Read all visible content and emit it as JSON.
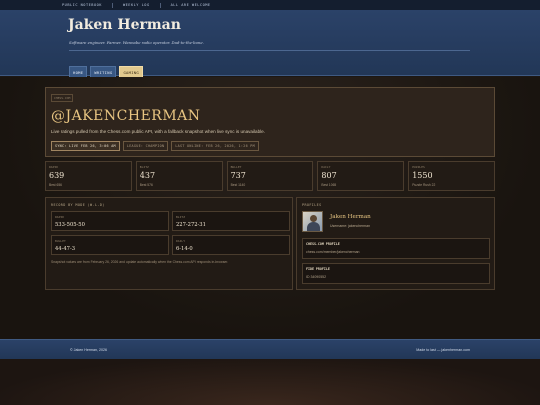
{
  "topnav": [
    "PUBLIC NOTEBOOK",
    "WEEKLY LOG",
    "ALL ARE WELCOME"
  ],
  "header": {
    "title": "Jaken Herman",
    "tagline": "Software engineer. Farmer. Wannabe radio operator. Dad-to-the-bone.",
    "nav": [
      {
        "label": "HOME",
        "active": false
      },
      {
        "label": "WRITING",
        "active": false
      },
      {
        "label": "GAMING",
        "active": true
      }
    ]
  },
  "hero": {
    "tag": "CHESS.COM",
    "title": "@JAKENCHERMAN",
    "description": "Live ratings pulled from the Chess.com public API, with a fallback snapshot when live sync is unavailable.",
    "chips": [
      {
        "label": "SYNC: LIVE FEB 26, 3:06 AM",
        "live": true
      },
      {
        "label": "LEAGUE: CHAMPION",
        "live": false
      },
      {
        "label": "LAST ONLINE: FEB 26, 2026, 1:26 PM",
        "live": false
      }
    ]
  },
  "stats": [
    {
      "label": "RAPID",
      "value": "639",
      "sub": "Best 656"
    },
    {
      "label": "BLITZ",
      "value": "437",
      "sub": "Best 576"
    },
    {
      "label": "BULLET",
      "value": "737",
      "sub": "Best 1140"
    },
    {
      "label": "DAILY",
      "value": "807",
      "sub": "Best 1065"
    },
    {
      "label": "PUZZLES",
      "value": "1550",
      "sub": "Puzzle Rush 22"
    }
  ],
  "record": {
    "heading": "RECORD BY MODE (W-L-D)",
    "items": [
      {
        "label": "RAPID",
        "value": "533-505-50"
      },
      {
        "label": "BLITZ",
        "value": "227-272-31"
      },
      {
        "label": "BULLET",
        "value": "44-47-3"
      },
      {
        "label": "DAILY",
        "value": "6-14-0"
      }
    ],
    "note": "Snapshot values are from February 26, 2026 and update automatically when the Chess.com API responds in-browser."
  },
  "profiles": {
    "heading": "PROFILES",
    "name": "Jaken Herman",
    "username": "Username: jakencherman",
    "boxes": [
      {
        "label": "CHESS.COM PROFILE",
        "value": "chess.com/member/jakencherman"
      },
      {
        "label": "FIDE PROFILE",
        "value": "ID 34090552"
      }
    ]
  },
  "footer": {
    "left": "© Jaken Herman, 2026",
    "right": "Made to last — jakenherman.com"
  }
}
